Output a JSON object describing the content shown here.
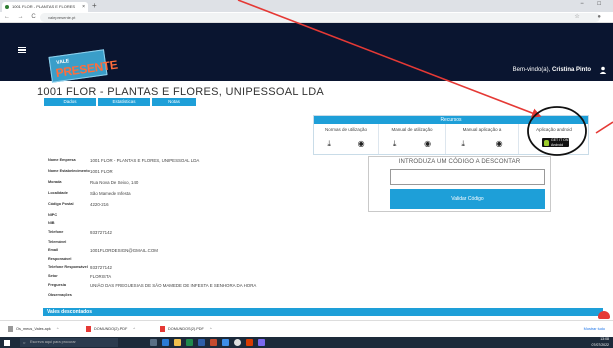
{
  "browser": {
    "tab_title": "1001 FLOR - PLANTAS E FLORES",
    "new_tab": "+",
    "close_tab": "×",
    "window_controls": "−  □",
    "nav_icons": "←  →  C  ⌂",
    "url": "valepresente.pt",
    "address_icons": "☆ ●"
  },
  "header": {
    "menu_icon": "menu-icon",
    "logo_line1": "VALE",
    "logo_line2": "PRESENTE",
    "welcome_prefix": "Bem-vindo(a),",
    "user_name": "Cristina Pinto"
  },
  "company": {
    "title": "1001 FLOR - PLANTAS E FLORES, UNIPESSOAL LDA",
    "tabs": [
      "Dados",
      "Estatísticas",
      "Notas"
    ]
  },
  "recursos": {
    "title": "Recursos",
    "columns": [
      {
        "header": "Normas de utilização",
        "icons": [
          "⤓",
          "◉"
        ]
      },
      {
        "header": "Manual de utilização",
        "icons": [
          "⤓",
          "◉"
        ]
      },
      {
        "header": "Manual aplicação a",
        "icons": [
          "⤓",
          "◉"
        ]
      },
      {
        "header": "Aplicação android",
        "badge_top": "GET IT ON",
        "badge_bottom": "Android"
      }
    ]
  },
  "code": {
    "title": "INTRODUZA UM CÓDIGO A DESCONTAR",
    "input_value": "",
    "button": "Validar Código"
  },
  "info": [
    {
      "label": "Nome Empresa",
      "value": "1001 FLOR - PLANTAS E FLORES, UNIPESSOAL LDA"
    },
    {
      "label": "Nome Estabelecimento",
      "value": "1001 FLOR"
    },
    {
      "label": "Morada",
      "value": "Rua Nova De Seixo, 140"
    },
    {
      "label": "Localidade",
      "value": "São Mamede Infesta"
    },
    {
      "label": "Código Postal",
      "value": "4220-216"
    },
    {
      "label": "NIPC",
      "value": ""
    },
    {
      "label": "NIB",
      "value": ""
    },
    {
      "label": "Telefone",
      "value": "933727142"
    },
    {
      "label": "Telemóvel",
      "value": ""
    },
    {
      "label": "Email",
      "value": "1001FLORDESIGN@GMAIL.COM"
    },
    {
      "label": "Responsável",
      "value": ""
    },
    {
      "label": "Telefone Responsável",
      "value": "933727142"
    },
    {
      "label": "Setor",
      "value": "FLORISTA"
    },
    {
      "label": "Freguesia",
      "value": "UNIÃO DAS FREGUESIAS DE SÃO MAMEDE DE INFESTA E SENHORA DA HORA"
    },
    {
      "label": "Observações",
      "value": ""
    }
  ],
  "vales": {
    "title": "Vales descontados"
  },
  "downloads": {
    "items": [
      "Os_meus_Vales.apk",
      "DOMUNDO(2).PDF",
      "DOMUNDOS(2).PDF"
    ],
    "show_all": "Mostrar tudo"
  },
  "taskbar": {
    "search_placeholder": "Escreva aqui para procurar",
    "time": "13:08",
    "date": "07/07/2022"
  },
  "colors": {
    "header_bg": "#0a1530",
    "accent": "#1e9fd8",
    "annotation": "#e53935"
  }
}
